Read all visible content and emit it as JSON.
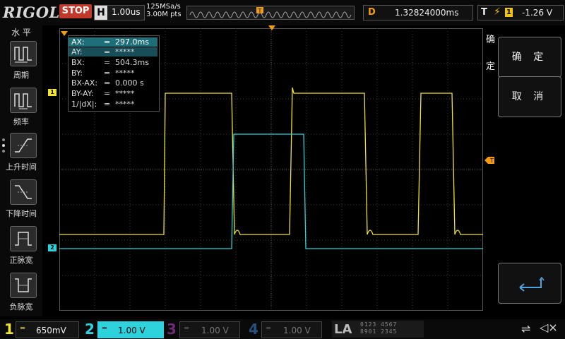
{
  "header": {
    "brand": "RIGOL",
    "run_state": "STOP",
    "timebase_label": "H",
    "timebase_value": "1.00us",
    "sample_rate": "125MSa/s",
    "memory_depth": "3.00M pts",
    "delay_label": "D",
    "delay_value": "1.32824000ms",
    "trigger_label": "T",
    "trigger_channel": "1",
    "trigger_level": "-1.26 V"
  },
  "left_menu": {
    "title": "水 平",
    "items": [
      {
        "label": "周期",
        "icon": "period-icon"
      },
      {
        "label": "频率",
        "icon": "frequency-icon"
      },
      {
        "label": "上升时间",
        "icon": "rise-time-icon"
      },
      {
        "label": "下降时间",
        "icon": "fall-time-icon"
      },
      {
        "label": "正脉宽",
        "icon": "positive-width-icon"
      },
      {
        "label": "负脉宽",
        "icon": "negative-width-icon"
      }
    ]
  },
  "cursor_table": {
    "rows": [
      {
        "key": "AX:",
        "eq": "=",
        "val": "297.0ms"
      },
      {
        "key": "AY:",
        "eq": "=",
        "val": "*****"
      },
      {
        "key": "BX:",
        "eq": "=",
        "val": "504.3ms"
      },
      {
        "key": "BY:",
        "eq": "=",
        "val": "*****"
      },
      {
        "key": "BX-AX:",
        "eq": "=",
        "val": "0.000 s"
      },
      {
        "key": "BY-AY:",
        "eq": "=",
        "val": "*****"
      },
      {
        "key": "1/|dX|:",
        "eq": "=",
        "val": "*****"
      }
    ]
  },
  "right_menu": {
    "title_chars": [
      "确",
      "定"
    ],
    "confirm_label": "确 定",
    "cancel_label": "取 消"
  },
  "markers": {
    "ch1": "1",
    "ch2": "2"
  },
  "channels": [
    {
      "num": "1",
      "coupling": "═",
      "scale": "650mV",
      "color": "#f1e42f",
      "active": false
    },
    {
      "num": "2",
      "coupling": "═",
      "scale": "1.00 V",
      "color": "#2ed2dc",
      "active": true
    },
    {
      "num": "3",
      "coupling": "═",
      "scale": "1.00 V",
      "color": "#c24bd0",
      "active": false
    },
    {
      "num": "4",
      "coupling": "═",
      "scale": "1.00 V",
      "color": "#3d7ed6",
      "active": false
    }
  ],
  "la": {
    "label": "LA",
    "digits_row1": "0123 4567",
    "digits_row2": "8901 2345"
  },
  "colors": {
    "ch1": "#f1e42f",
    "ch2": "#2ed2dc",
    "accent": "#f39c12",
    "stop": "#c0392b"
  }
}
